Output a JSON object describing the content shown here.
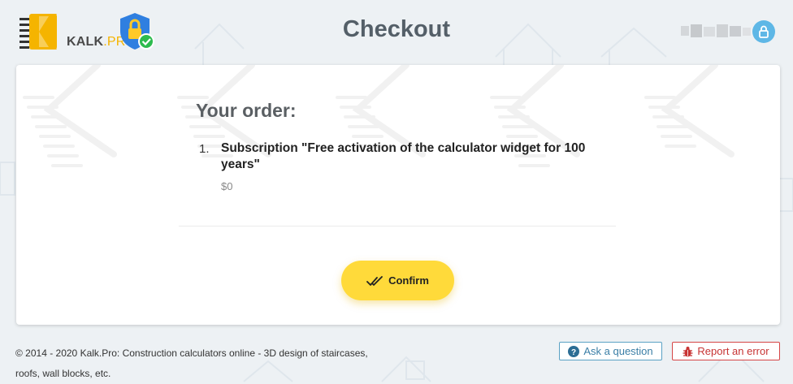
{
  "header": {
    "logo_text": "KALK",
    "logo_suffix": ".PRO",
    "title": "Checkout"
  },
  "order": {
    "heading": "Your order:",
    "items": [
      {
        "number": "1.",
        "name": "Subscription \"Free activation of the calculator widget for 100 years\"",
        "price": "$0"
      }
    ]
  },
  "actions": {
    "confirm_label": "Confirm"
  },
  "footer": {
    "copyright": "© 2014 - 2020 Kalk.Pro: Construction calculators online - 3D design of staircases, roofs, wall blocks, etc.",
    "ask_label": "Ask a question",
    "report_label": "Report an error"
  },
  "colors": {
    "accent": "#ffda3a",
    "brand_yellow": "#f5b400",
    "info": "#3a7ea6",
    "error": "#c73333",
    "lock": "#5eb7e6"
  },
  "icons": [
    "kalk-logo-icon",
    "security-shield-icon",
    "lock-icon",
    "double-check-icon",
    "question-icon",
    "bug-icon"
  ]
}
